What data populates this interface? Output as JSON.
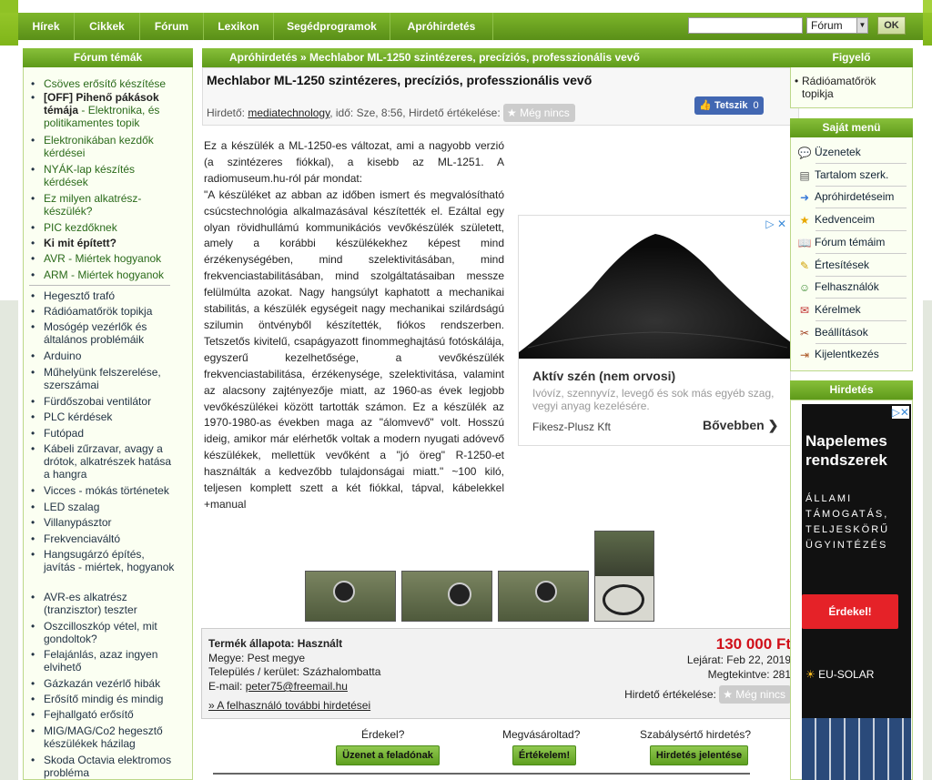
{
  "nav": {
    "items": [
      "Hírek",
      "Cikkek",
      "Fórum",
      "Lexikon",
      "Segédprogramok",
      "Apróhirdetés"
    ],
    "search_value": "",
    "select_value": "Fórum",
    "ok_label": "OK"
  },
  "forum_topics": {
    "title": "Fórum témák",
    "items": [
      {
        "text": "Csöves erősítő készítése",
        "bold": "",
        "style": "g"
      },
      {
        "text": " - Elektronika, és politikamentes topik",
        "bold": "[OFF] Pihenő pákások témája",
        "style": "g"
      },
      {
        "text": "Elektronikában kezdők kérdései",
        "bold": "",
        "style": "g"
      },
      {
        "text": "NYÁK-lap készítés kérdések",
        "bold": "",
        "style": "g"
      },
      {
        "text": "Ez milyen alkatrész-készülék?",
        "bold": "",
        "style": "g"
      },
      {
        "text": "PIC kezdőknek",
        "bold": "",
        "style": "g"
      },
      {
        "text": "",
        "bold": "Ki mit épített?",
        "style": "g"
      },
      {
        "text": "AVR - Miértek hogyanok",
        "bold": "",
        "style": "g"
      },
      {
        "text": "ARM - Miértek hogyanok",
        "bold": "",
        "style": "g"
      },
      {
        "text": "Hegesztő trafó",
        "bold": "",
        "style": "n"
      },
      {
        "text": "Rádióamatőrök topikja",
        "bold": "",
        "style": "n"
      },
      {
        "text": "Mosógép vezérlők és általános problémáik",
        "bold": "",
        "style": "n"
      },
      {
        "text": "Arduino",
        "bold": "",
        "style": "n"
      },
      {
        "text": "Műhelyünk felszerelése, szerszámai",
        "bold": "",
        "style": "n"
      },
      {
        "text": "Fürdőszobai ventilátor",
        "bold": "",
        "style": "n"
      },
      {
        "text": "PLC kérdések",
        "bold": "",
        "style": "n"
      },
      {
        "text": "Futópad",
        "bold": "",
        "style": "n"
      },
      {
        "text": "Kábeli zűrzavar, avagy a drótok, alkatrészek hatása a hangra",
        "bold": "",
        "style": "n"
      },
      {
        "text": "Vicces - mókás történetek",
        "bold": "",
        "style": "n"
      },
      {
        "text": "LED szalag",
        "bold": "",
        "style": "n"
      },
      {
        "text": "Villanypásztor",
        "bold": "",
        "style": "n"
      },
      {
        "text": "Frekvenciaváltó",
        "bold": "",
        "style": "n"
      },
      {
        "text": "Hangsugárzó építés, javítás - miértek, hogyanok",
        "bold": "",
        "style": "n"
      },
      {
        "text": "AVR-es alkatrész (tranzisztor) teszter",
        "bold": "",
        "style": "n"
      },
      {
        "text": "Oszcilloszkóp vétel, mit gondoltok?",
        "bold": "",
        "style": "n"
      },
      {
        "text": "Felajánlás, azaz ingyen elvihető",
        "bold": "",
        "style": "n"
      },
      {
        "text": "Gázkazán vezérlő hibák",
        "bold": "",
        "style": "n"
      },
      {
        "text": "Erősítő mindig és mindig",
        "bold": "",
        "style": "n"
      },
      {
        "text": "Fejhallgató erősítő",
        "bold": "",
        "style": "n"
      },
      {
        "text": "MIG/MAG/Co2 hegesztő készülékek házilag",
        "bold": "",
        "style": "n"
      },
      {
        "text": "Skoda Octavia elektromos probléma",
        "bold": "",
        "style": "n"
      }
    ]
  },
  "breadcrumb": "Apróhirdetés » Mechlabor ML-1250 szintézeres, precíziós, professzionális vevő",
  "ad": {
    "title": "Mechlabor ML-1250 szintézeres, precíziós, professzionális vevő",
    "meta_prefix": "Hirdető:",
    "advertiser": "mediatechnology",
    "meta_mid": ", idő: Sze, 8:56, Hirdető értékelése:",
    "rating": "Még nincs",
    "like_label": "Tetszik",
    "like_count": "0",
    "description_p1": "Ez a készülék a ML-1250-es változat, ami a nagyobb verzió (a szintézeres fiókkal), a kisebb az ML-1251. A radiomuseum.hu-ról pár mondat:",
    "description_p2": "\"A készüléket az abban az időben ismert és megvalósítható csúcstechnológia alkalmazásával készítették el. Ezáltal egy olyan rövidhullámú kommunikációs vevőkészülék született, amely a korábbi készülékekhez képest mind érzékenységében, mind szelektivitásában, mind frekvenciastabilitásában, mind szolgáltatásaiban messze felülmúlta azokat. Nagy hangsúlyt kaphatott a mechanikai stabilitás, a készülék egységeit nagy mechanikai szilárdságú szilumin öntvényből készítették, fiókos rendszerben. Tetszetős kivitelű, csapágyazott finommeghajtású fotóskálája, egyszerű kezelhetősége, a vevőkészülék frekvenciastabilitása, érzékenysége, szelektivitása, valamint az alacsony zajtényezője miatt, az 1960-as évek legjobb vevőkészülékei között tartották számon. Ez a készülék az 1970-1980-as években maga az \"álomvevő\" volt. Hosszú ideig, amikor már elérhetők voltak a modern nyugati adóvevő készülékek, mellettük vevőként a \"jó öreg\" R-1250-et használták a kedvezőbb tulajdonságai miatt.\" ~100 kiló, teljesen komplett szett a két fiókkal, tápval, kábelekkel +manual"
  },
  "banner_ad": {
    "title": "Aktív szén (nem orvosi)",
    "text": "Ivóvíz, szennyvíz, levegő és sok más egyéb szag, vegyi anyag kezelésére.",
    "advertiser": "Fikesz-Plusz Kft",
    "cta": "Bővebben"
  },
  "info": {
    "condition": "Termék állapota: Használt",
    "county": "Megye: Pest megye",
    "city": "Település / kerület: Százhalombatta",
    "email_label": "E-mail:",
    "email": "peter75@freemail.hu",
    "more_link": "» A felhasználó további hirdetései",
    "price": "130 000 Ft",
    "expiry": "Lejárat: Feb 22, 2019",
    "views": "Megtekintve: 281",
    "rating_label": "Hirdető értékelése:",
    "rating": "Még nincs"
  },
  "actions": [
    {
      "question": "Érdekel?",
      "button": "Üzenet a feladónak"
    },
    {
      "question": "Megvásároltad?",
      "button": "Értékelem!"
    },
    {
      "question": "Szabálysértő hirdetés?",
      "button": "Hirdetés jelentése"
    }
  ],
  "watch": {
    "title": "Figyelő",
    "item": "Rádióamatőrök topikja"
  },
  "own_menu": {
    "title": "Saját menü",
    "items": [
      "Üzenetek",
      "Tartalom szerk.",
      "Apróhirdetéseim",
      "Kedvenceim",
      "Fórum témáim",
      "Értesítések",
      "Felhasználók",
      "Kérelmek",
      "Beállítások",
      "Kijelentkezés"
    ]
  },
  "right_ad": {
    "title": "Hirdetés",
    "headline": "Napelemes rendszerek",
    "sub": "ÁLLAMI TÁMOGATÁS, TELJESKÖRŰ ÜGYINTÉZÉS",
    "cta": "Érdekel!",
    "brand": "EU-SOLAR"
  }
}
